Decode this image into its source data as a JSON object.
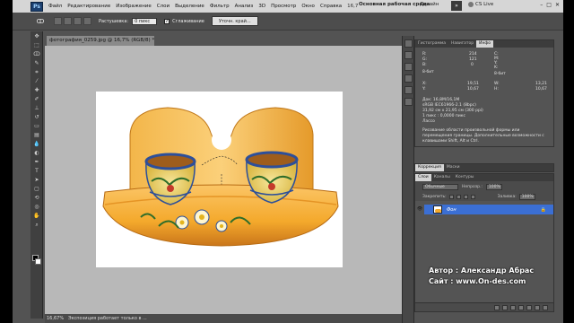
{
  "menubar": {
    "logo": "Ps",
    "items": [
      "Файл",
      "Редактирование",
      "Изображение",
      "Слои",
      "Выделение",
      "Фильтр",
      "Анализ",
      "3D",
      "Просмотр",
      "Окно",
      "Справка"
    ],
    "zoom": "16,7",
    "workspace": "Основная рабочая среда",
    "design": "Дизайн",
    "expand": "»",
    "cslive": "CS Live",
    "window_buttons": [
      "–",
      "□",
      "✕"
    ]
  },
  "options": {
    "feather_label": "Растушевка:",
    "feather_value": "0 пикс",
    "antialias_label": "Сглаживание",
    "refine_label": "Уточн. край..."
  },
  "document": {
    "tab_title": "фотография_0259.jpg @ 16,7% (RGB/8) *",
    "status_zoom": "16,67%",
    "status_info": "Экспозиция работает только в ..."
  },
  "panels": {
    "info_tabs": [
      "Гистограмма",
      "Навигатор",
      "Инфо"
    ],
    "info": {
      "r": "R:",
      "g": "G:",
      "b": "B:",
      "r_val": "214",
      "g_val": "121",
      "b_val": "0",
      "bit1": "8-бит",
      "c": "C:",
      "m": "M:",
      "y": "Y:",
      "k": "K:",
      "bit2": "8-бит",
      "x": "X:",
      "y_coord": "Y:",
      "x_val": "19,51",
      "y_val": "10,67",
      "w": "W:",
      "h": "H:",
      "w_val": "13,21",
      "h_val": "10,67",
      "doc": "Док: 16,8M/16,1M",
      "profile": "sRGB IEC61966-2.1 (8bpc)",
      "size": "31,92 см x 21,95 см (300 ppi)",
      "ratio": "1 пикс : 0,0000 пикс",
      "tool": "Лассо",
      "description": "Рисование области произвольной формы или перемещения границы. Дополнительные возможности с клавишами Shift, Alt и Ctrl."
    },
    "correction_tabs": [
      "Коррекция",
      "Маски"
    ],
    "layers_tabs": [
      "Слои",
      "Каналы",
      "Контуры"
    ],
    "layers": {
      "blend_mode": "Обычные",
      "opacity_label": "Непрозр.:",
      "opacity": "100%",
      "lock_label": "Закрепить:",
      "fill_label": "Заливка:",
      "fill": "100%",
      "layer_name": "Фон"
    }
  },
  "credits": {
    "author": "Автор : Александр Абрас",
    "site": "Сайт : www.On-des.com"
  },
  "colors": {
    "accent": "#3b6fd4",
    "app_bg": "#535353",
    "canvas_bg": "#b8b8b8",
    "wood": "#f4a92c"
  }
}
